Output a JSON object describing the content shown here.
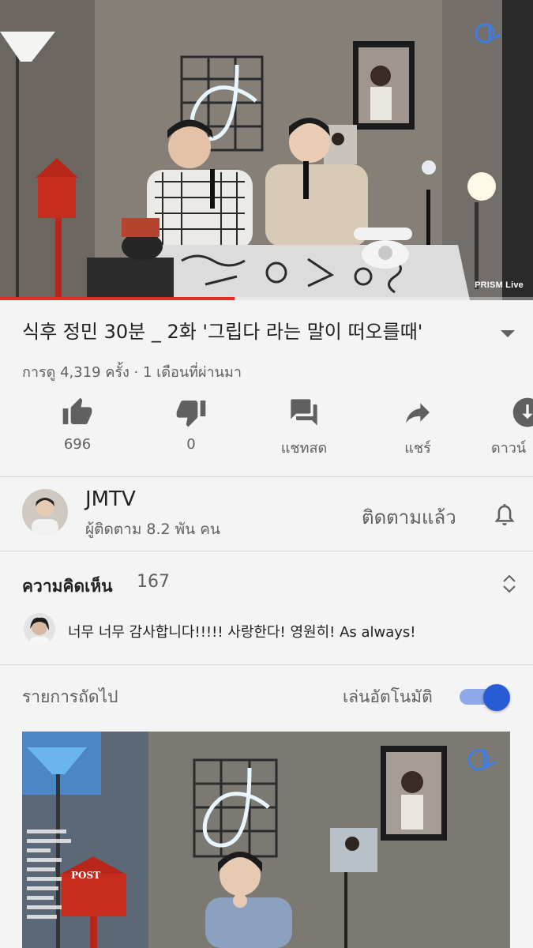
{
  "video": {
    "watermark": "PRISM Live",
    "progress": 0.44,
    "title": "식후 정민 30분 _ 2화 '그립다 라는 말이 떠오를때'",
    "meta": "การดู 4,319 ครั้ง · 1 เดือนที่ผ่านมา"
  },
  "actions": {
    "like": "696",
    "dislike": "0",
    "live_chat": "แชทสด",
    "share": "แชร์",
    "download": "ดาวน์"
  },
  "channel": {
    "name": "JMTV",
    "subscribers": "ผู้ติดตาม 8.2 พัน คน",
    "subscribe_state": "ติดตามแล้ว"
  },
  "comments": {
    "heading": "ความคิดเห็น",
    "count": "167",
    "top_comment": "너무 너무 감사합니다!!!!! 사랑한다! 영원히! As always!"
  },
  "up_next": {
    "label": "รายการถัดไป",
    "autoplay_label": "เล่นอัตโนมัติ",
    "autoplay_on": true,
    "thumbnail_sign": "POST"
  },
  "colors": {
    "progress": "#e52d27",
    "toggle_knob": "#2a5bd7",
    "toggle_track": "#8fa9e8",
    "secondary_text": "#606060"
  },
  "icons": [
    "thumbs-up-icon",
    "thumbs-down-icon",
    "live-chat-icon",
    "share-icon",
    "download-icon",
    "bell-icon",
    "sort-icon",
    "expand-caret-icon"
  ]
}
